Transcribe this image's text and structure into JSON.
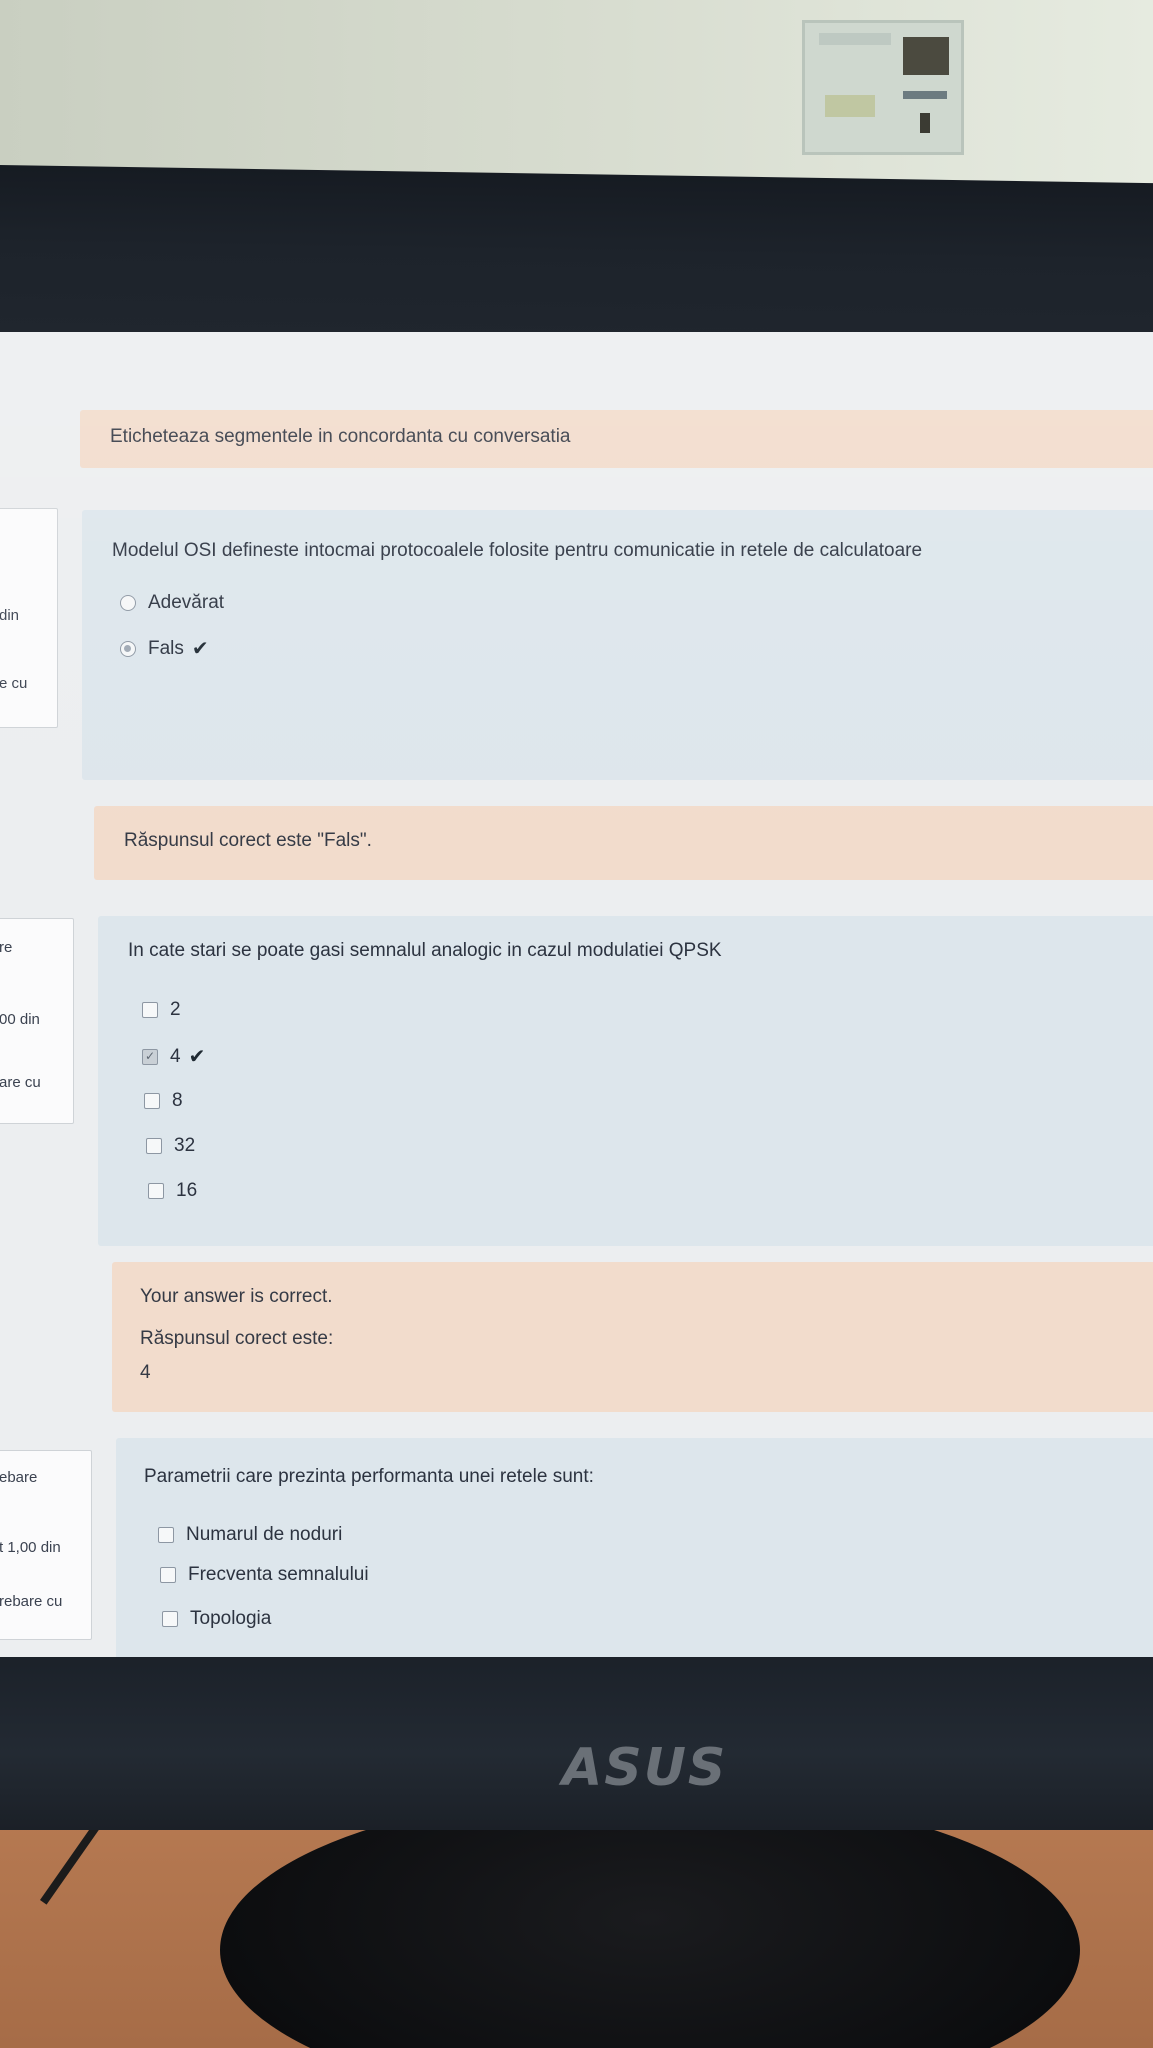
{
  "q1": {
    "feedback_text": "Eticheteaza segmentele in concordanta cu conversatia"
  },
  "q2": {
    "info": {
      "line1": "din",
      "line2": "e cu"
    },
    "text": "Modelul OSI defineste intocmai protocoalele folosite pentru comunicatie in retele de calculatoare",
    "options": [
      {
        "label": "Adevărat",
        "checked": false,
        "correct": false
      },
      {
        "label": "Fals",
        "checked": true,
        "correct": true
      }
    ],
    "feedback": "Răspunsul corect este \"Fals\"."
  },
  "q3": {
    "info": {
      "line1": "re",
      "line2": "00 din",
      "line3": "are cu"
    },
    "text": "In cate stari se poate gasi semnalul analogic in cazul modulatiei QPSK",
    "options": [
      {
        "label": "2",
        "checked": false,
        "correct": false
      },
      {
        "label": "4",
        "checked": true,
        "correct": true
      },
      {
        "label": "8",
        "checked": false,
        "correct": false
      },
      {
        "label": "32",
        "checked": false,
        "correct": false
      },
      {
        "label": "16",
        "checked": false,
        "correct": false
      }
    ],
    "feedback": {
      "line1": "Your answer is correct.",
      "line2": "Răspunsul corect este:",
      "line3": "4"
    }
  },
  "q4": {
    "info": {
      "line1": "ebare",
      "line2": "t 1,00 din",
      "line3": "rebare cu"
    },
    "text": "Parametrii care prezinta performanta unei retele sunt:",
    "options": [
      {
        "label": "Numarul de noduri",
        "checked": false
      },
      {
        "label": "Frecventa semnalului",
        "checked": false
      },
      {
        "label": "Topologia",
        "checked": false
      }
    ]
  },
  "monitor_brand": "ASUS"
}
